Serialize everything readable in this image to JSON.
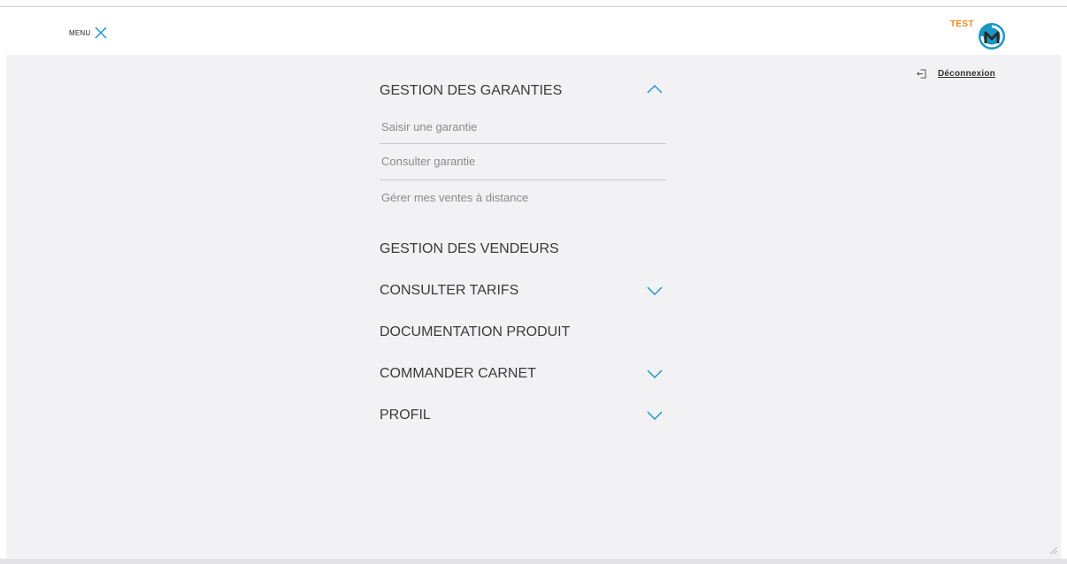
{
  "header": {
    "menu_label": "MENU",
    "logo_text": "TEST",
    "logo_colors": {
      "text": "#f08a24",
      "mark_primary": "#1a96c2",
      "mark_secondary": "#2a2a2a"
    }
  },
  "account": {
    "logout_label": "Déconnexion"
  },
  "nav": {
    "sections": [
      {
        "label": "GESTION DES GARANTIES",
        "chevron": "up",
        "items": [
          {
            "label": "Saisir une garantie"
          },
          {
            "label": "Consulter garantie"
          },
          {
            "label": "Gérer mes ventes à distance"
          }
        ]
      },
      {
        "label": "GESTION DES VENDEURS",
        "chevron": "none"
      },
      {
        "label": "CONSULTER TARIFS",
        "chevron": "down"
      },
      {
        "label": "DOCUMENTATION PRODUIT",
        "chevron": "none"
      },
      {
        "label": "COMMANDER CARNET",
        "chevron": "down"
      },
      {
        "label": "PROFIL",
        "chevron": "down"
      }
    ]
  },
  "colors": {
    "accent": "#1a96c2",
    "background": "#f2f2f4"
  }
}
